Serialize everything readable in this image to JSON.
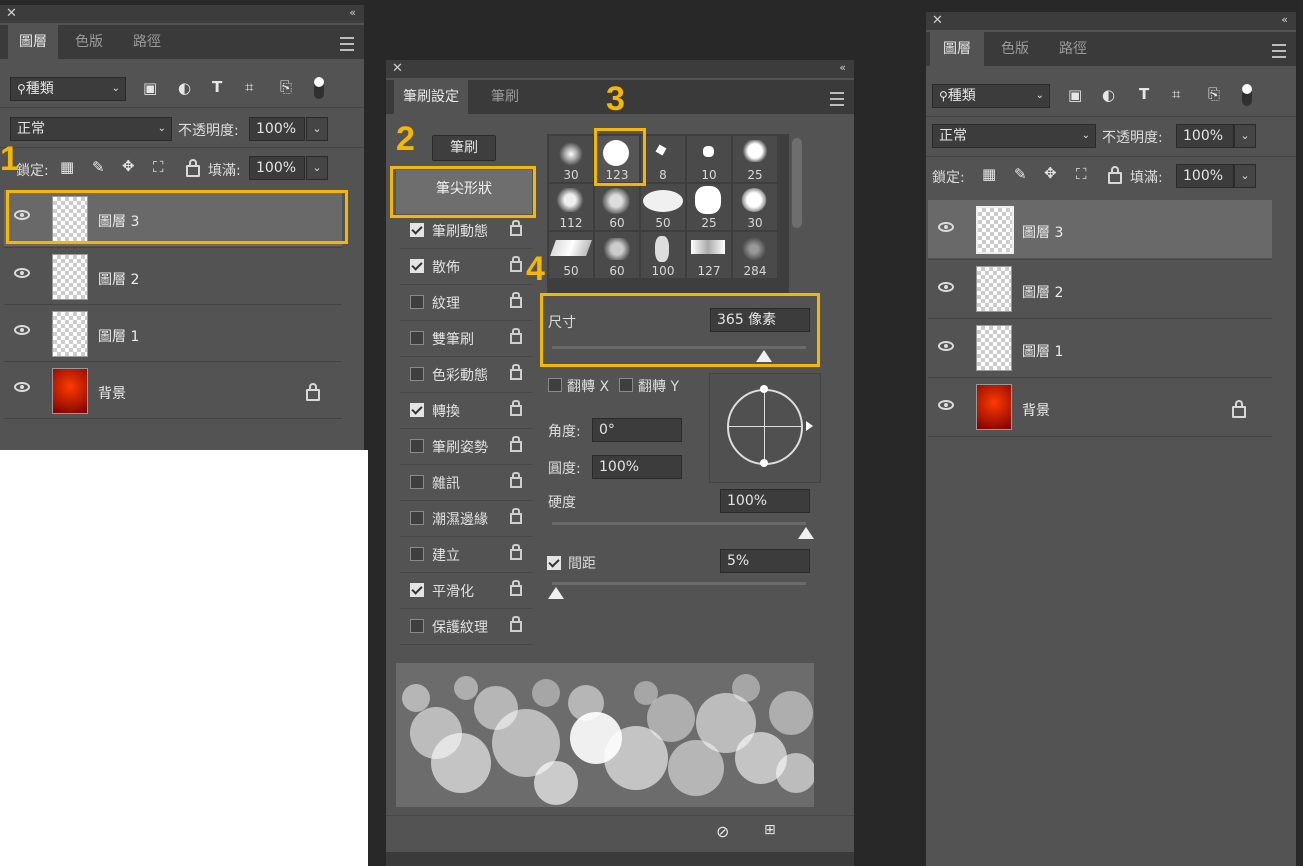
{
  "left_panel": {
    "tabs": [
      "圖層",
      "色版",
      "路徑"
    ],
    "filter_label": "種類",
    "blend_mode": "正常",
    "opacity_label": "不透明度:",
    "opacity_value": "100%",
    "lock_label": "鎖定:",
    "fill_label": "填滿:",
    "fill_value": "100%",
    "layers": [
      {
        "name": "圖層 3"
      },
      {
        "name": "圖層 2"
      },
      {
        "name": "圖層 1"
      },
      {
        "name": "背景"
      }
    ]
  },
  "brush_panel": {
    "tabs": [
      "筆刷設定",
      "筆刷"
    ],
    "brush_button": "筆刷",
    "tip_shape_button": "筆尖形狀",
    "options": [
      {
        "label": "筆刷動態",
        "checked": true
      },
      {
        "label": "散佈",
        "checked": true
      },
      {
        "label": "紋理",
        "checked": false
      },
      {
        "label": "雙筆刷",
        "checked": false
      },
      {
        "label": "色彩動態",
        "checked": false
      },
      {
        "label": "轉換",
        "checked": true
      },
      {
        "label": "筆刷姿勢",
        "checked": false
      },
      {
        "label": "雜訊",
        "checked": false
      },
      {
        "label": "潮濕邊緣",
        "checked": false
      },
      {
        "label": "建立",
        "checked": false
      },
      {
        "label": "平滑化",
        "checked": true
      },
      {
        "label": "保護紋理",
        "checked": false
      }
    ],
    "tip_sizes": [
      "30",
      "123",
      "8",
      "10",
      "25",
      "112",
      "60",
      "50",
      "25",
      "30",
      "50",
      "60",
      "100",
      "127",
      "284"
    ],
    "size_label": "尺寸",
    "size_value": "365 像素",
    "flip_x": "翻轉 X",
    "flip_y": "翻轉 Y",
    "angle_label": "角度:",
    "angle_value": "0°",
    "roundness_label": "圓度:",
    "roundness_value": "100%",
    "hardness_label": "硬度",
    "hardness_value": "100%",
    "spacing_label": "間距",
    "spacing_value": "5%"
  },
  "right_panel": {
    "tabs": [
      "圖層",
      "色版",
      "路徑"
    ],
    "filter_label": "種類",
    "blend_mode": "正常",
    "opacity_label": "不透明度:",
    "opacity_value": "100%",
    "lock_label": "鎖定:",
    "fill_label": "填滿:",
    "fill_value": "100%",
    "layers": [
      {
        "name": "圖層 3"
      },
      {
        "name": "圖層 2"
      },
      {
        "name": "圖層 1"
      },
      {
        "name": "背景"
      }
    ]
  },
  "annotations": [
    "1",
    "2",
    "3",
    "4"
  ],
  "colors": {
    "highlight": "#f5b800",
    "panel": "#535353",
    "selected_row": "#696969"
  }
}
